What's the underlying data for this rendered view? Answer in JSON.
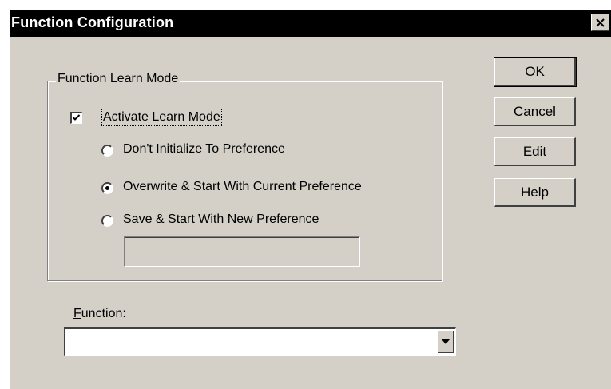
{
  "window": {
    "title": "Function Configuration",
    "close_glyph": "X"
  },
  "learn_mode_group": {
    "title": "Function Learn Mode",
    "activate_checkbox": {
      "label": "Activate Learn Mode",
      "checked": true
    },
    "options": [
      {
        "label": "Don't Initialize To Preference",
        "selected": false
      },
      {
        "label": "Overwrite & Start With Current Preference",
        "selected": true
      },
      {
        "label": "Save & Start With New Preference",
        "selected": false
      }
    ],
    "new_preference_value": ""
  },
  "function": {
    "label_accel": "F",
    "label_rest": "unction:",
    "selected_value": ""
  },
  "buttons": {
    "ok": "OK",
    "cancel": "Cancel",
    "edit": "Edit",
    "help": "Help"
  },
  "icons": {
    "close": "close-icon",
    "check": "check-icon",
    "dropdown": "chevron-down-icon"
  }
}
